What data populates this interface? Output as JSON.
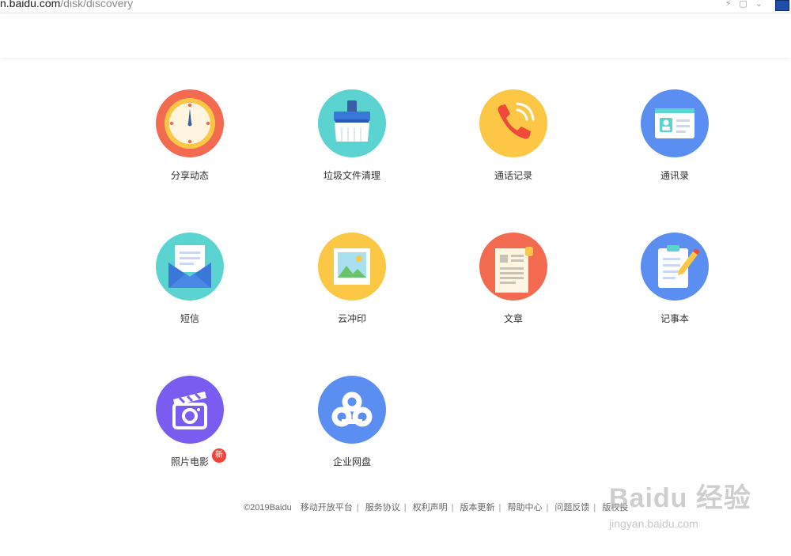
{
  "browser": {
    "url_host": "n.baidu.com",
    "url_path": "/disk/discovery"
  },
  "apps": [
    {
      "label": "分享动态",
      "icon": "clock-icon",
      "color": "#f26b50"
    },
    {
      "label": "垃圾文件清理",
      "icon": "broom-icon",
      "color": "#5ad3d1"
    },
    {
      "label": "通话记录",
      "icon": "phone-icon",
      "color": "#fcc745"
    },
    {
      "label": "通讯录",
      "icon": "contact-card-icon",
      "color": "#5a8ef0"
    },
    {
      "label": "短信",
      "icon": "envelope-icon",
      "color": "#5ad3d1"
    },
    {
      "label": "云冲印",
      "icon": "photo-print-icon",
      "color": "#fcc745"
    },
    {
      "label": "文章",
      "icon": "document-icon",
      "color": "#f26b50"
    },
    {
      "label": "记事本",
      "icon": "notepad-icon",
      "color": "#5a8ef0"
    },
    {
      "label": "照片电影",
      "icon": "clapperboard-icon",
      "color": "#7b5cf0",
      "badge": "新"
    },
    {
      "label": "企业网盘",
      "icon": "cloud-icon",
      "color": "#5a8ef0"
    }
  ],
  "footer": {
    "copyright": "©2019Baidu",
    "links": [
      "移动开放平台",
      "服务协议",
      "权利声明",
      "版本更新",
      "帮助中心",
      "问题反馈",
      "版权投"
    ]
  },
  "watermark": {
    "brand": "Baidu 经验",
    "domain": "jingyan.baidu.com"
  }
}
